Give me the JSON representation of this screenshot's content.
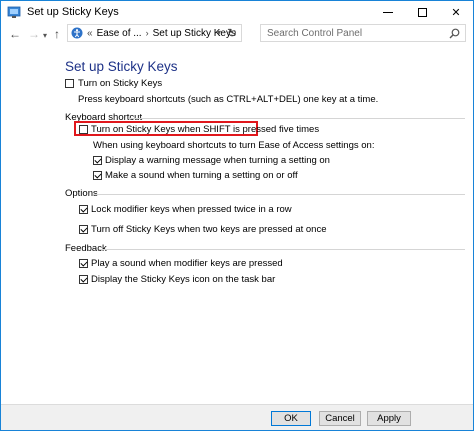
{
  "window": {
    "title": "Set up Sticky Keys",
    "min_glyph": "",
    "close_glyph": "✕"
  },
  "nav": {
    "back_glyph": "←",
    "forward_glyph": "→",
    "dropdown_glyph": "▾",
    "up_glyph": "↑",
    "breadcrumb_overflow": "«",
    "breadcrumbs": [
      "Ease of ...",
      "Set up Sticky Keys"
    ],
    "crumb_separator": "›",
    "refresh_glyph": "↻",
    "search_placeholder": "Search Control Panel"
  },
  "page": {
    "heading": "Set up Sticky Keys",
    "turn_on": {
      "label": "Turn on Sticky Keys",
      "checked": false
    },
    "turn_on_description": "Press keyboard shortcuts (such as CTRL+ALT+DEL) one key at a time.",
    "keyboard_shortcut": {
      "title": "Keyboard shortcut",
      "shift_five": {
        "label": "Turn on Sticky Keys when SHIFT is pressed five times",
        "checked": false
      },
      "sub_caption": "When using keyboard shortcuts to turn Ease of Access settings on:",
      "warning": {
        "label": "Display a warning message when turning a setting on",
        "checked": true
      },
      "sound": {
        "label": "Make a sound when turning a setting on or off",
        "checked": true
      }
    },
    "options": {
      "title": "Options",
      "lock": {
        "label": "Lock modifier keys when pressed twice in a row",
        "checked": true
      },
      "turn_off": {
        "label": "Turn off Sticky Keys when two keys are pressed at once",
        "checked": true
      }
    },
    "feedback": {
      "title": "Feedback",
      "play_sound": {
        "label": "Play a sound when modifier keys are pressed",
        "checked": true
      },
      "display_icon": {
        "label": "Display the Sticky Keys icon on the task bar",
        "checked": true
      }
    }
  },
  "footer": {
    "ok": "OK",
    "cancel": "Cancel",
    "apply": "Apply"
  },
  "colors": {
    "heading": "#1e3287",
    "highlight": "#e0171c",
    "window_border": "#1883d7"
  }
}
